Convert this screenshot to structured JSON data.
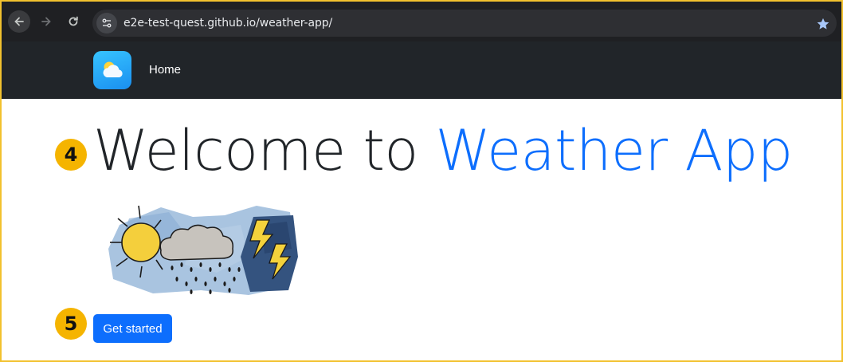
{
  "browser": {
    "url": "e2e-test-quest.github.io/weather-app/",
    "back_icon": "arrow-left-icon",
    "forward_icon": "arrow-right-icon",
    "reload_icon": "reload-icon",
    "site_info_icon": "tune-icon",
    "bookmark_icon": "star-icon"
  },
  "navbar": {
    "logo_icon": "weather-cloud-sun-icon",
    "home_label": "Home"
  },
  "main": {
    "title_prefix": "Welcome to ",
    "title_accent": "Weather App",
    "cta_label": "Get started",
    "step_badges": [
      "4",
      "5"
    ]
  },
  "colors": {
    "accent": "#0d6efd",
    "navbar_bg": "#212529",
    "badge": "#f5b400",
    "frame_border": "#f2c12e"
  }
}
